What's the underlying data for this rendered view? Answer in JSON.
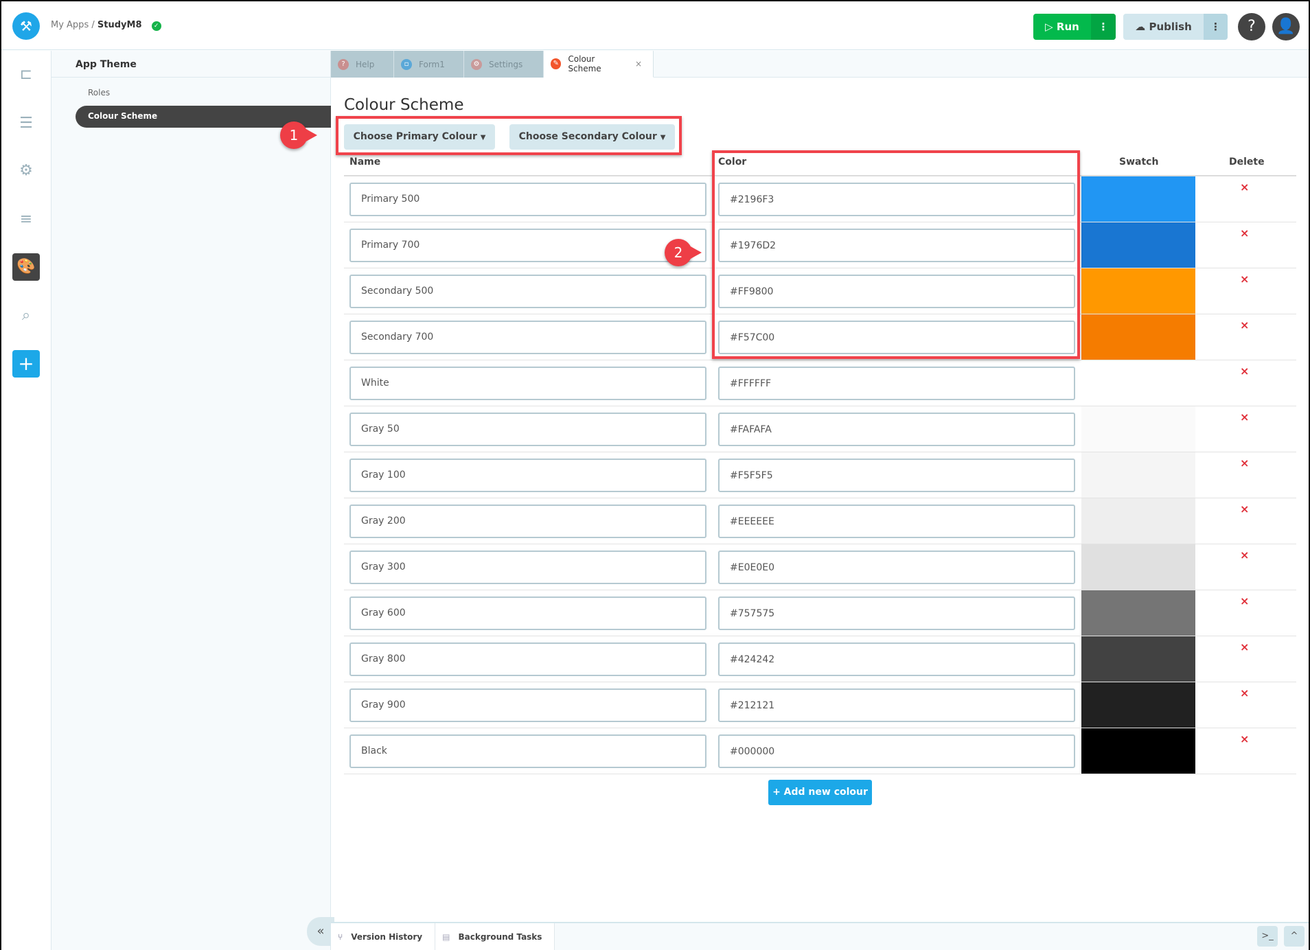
{
  "header": {
    "breadcrumb_root": "My Apps",
    "separator": "/",
    "app_name": "StudyM8",
    "run_label": "Run",
    "publish_label": "Publish",
    "help_label": "?"
  },
  "sidebar": {
    "title": "App Theme",
    "items": [
      {
        "label": "Roles"
      },
      {
        "label": "Colour Scheme",
        "selected": true
      }
    ]
  },
  "tabs": [
    {
      "label": "Help",
      "color": "#c98f8f"
    },
    {
      "label": "Form1",
      "color": "#5aa8d8"
    },
    {
      "label": "Settings",
      "color": "#c99a9a"
    },
    {
      "label": "Colour Scheme",
      "color": "#f2552c",
      "active": true,
      "close": "×"
    }
  ],
  "main": {
    "title": "Colour Scheme",
    "primary_button": "Choose Primary Colour",
    "secondary_button": "Choose Secondary Colour",
    "columns": {
      "name": "Name",
      "color": "Color",
      "swatch": "Swatch",
      "delete": "Delete"
    },
    "rows": [
      {
        "name": "Primary 500",
        "color": "#2196F3"
      },
      {
        "name": "Primary 700",
        "color": "#1976D2"
      },
      {
        "name": "Secondary 500",
        "color": "#FF9800"
      },
      {
        "name": "Secondary 700",
        "color": "#F57C00"
      },
      {
        "name": "White",
        "color": "#FFFFFF"
      },
      {
        "name": "Gray 50",
        "color": "#FAFAFA"
      },
      {
        "name": "Gray 100",
        "color": "#F5F5F5"
      },
      {
        "name": "Gray 200",
        "color": "#EEEEEE"
      },
      {
        "name": "Gray 300",
        "color": "#E0E0E0"
      },
      {
        "name": "Gray 600",
        "color": "#757575"
      },
      {
        "name": "Gray 800",
        "color": "#424242"
      },
      {
        "name": "Gray 900",
        "color": "#212121"
      },
      {
        "name": "Black",
        "color": "#000000"
      }
    ],
    "delete_glyph": "×",
    "add_button": "+ Add new colour"
  },
  "callouts": [
    "1",
    "2"
  ],
  "footer": {
    "version_history": "Version History",
    "background_tasks": "Background Tasks"
  }
}
